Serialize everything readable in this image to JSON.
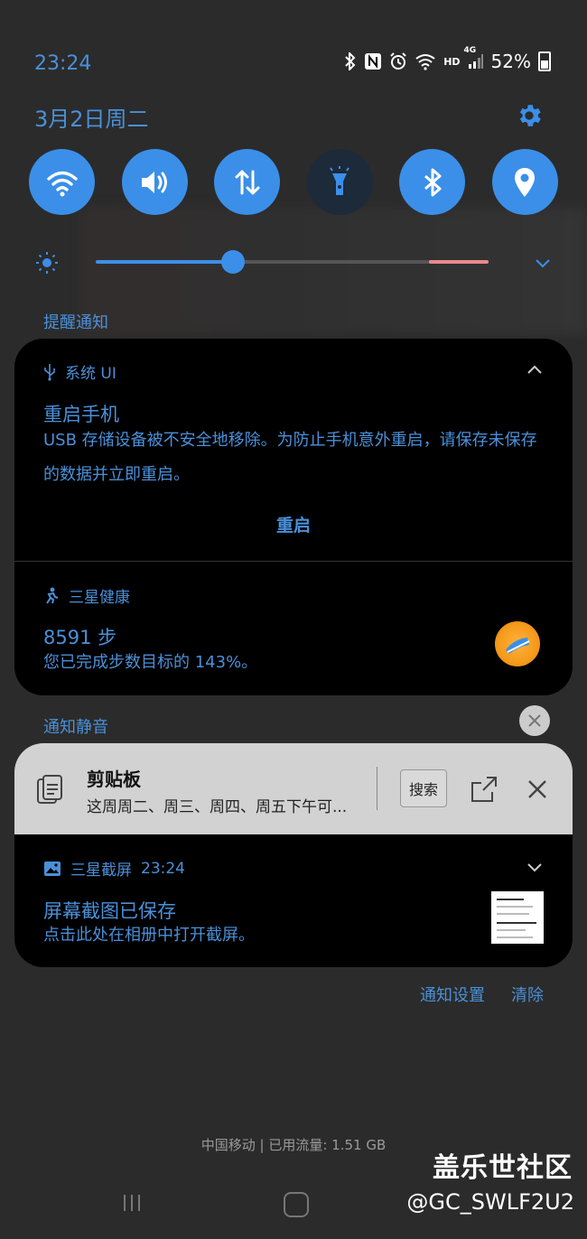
{
  "status_bar": {
    "time": "23:24",
    "icons": [
      "bluetooth-icon",
      "nfc-icon",
      "alarm-icon",
      "wifi-icon",
      "hd-icon",
      "4g-signal-icon"
    ],
    "hd": "HD",
    "net": "4G",
    "battery": "52%"
  },
  "header": {
    "date": "3月2日周二"
  },
  "quick_toggles": [
    {
      "name": "wifi",
      "active": true
    },
    {
      "name": "sound",
      "active": true
    },
    {
      "name": "mobile-data",
      "active": true
    },
    {
      "name": "flashlight",
      "active": false
    },
    {
      "name": "bluetooth",
      "active": true
    },
    {
      "name": "location",
      "active": true
    }
  ],
  "brightness": {
    "level": 0.35
  },
  "sections": {
    "alerts": "提醒通知",
    "silent": "通知静音"
  },
  "notifications": {
    "system_ui": {
      "app": "系统 UI",
      "title": "重启手机",
      "body": "USB 存储设备被不安全地移除。为防止手机意外重启，请保存未保存的数据并立即重启。",
      "action": "重启"
    },
    "health": {
      "app": "三星健康",
      "title": "8591 步",
      "body": "您已完成步数目标的 143%。"
    },
    "clipboard": {
      "title": "剪贴板",
      "text": "这周周二、周三、周四、周五下午可...",
      "search": "搜索"
    },
    "screenshot": {
      "app": "三星截屏",
      "time": "23:24",
      "title": "屏幕截图已保存",
      "body": "点击此处在相册中打开截屏。"
    }
  },
  "footer": {
    "settings": "通知设置",
    "clear": "清除",
    "carrier": "中国移动 | 已用流量: 1.51 GB"
  },
  "watermark": {
    "line1": "盖乐世社区",
    "line2": "@GC_SWLF2U2"
  },
  "colors": {
    "accent": "#3b8fe8",
    "text_accent": "#4a90d9"
  }
}
